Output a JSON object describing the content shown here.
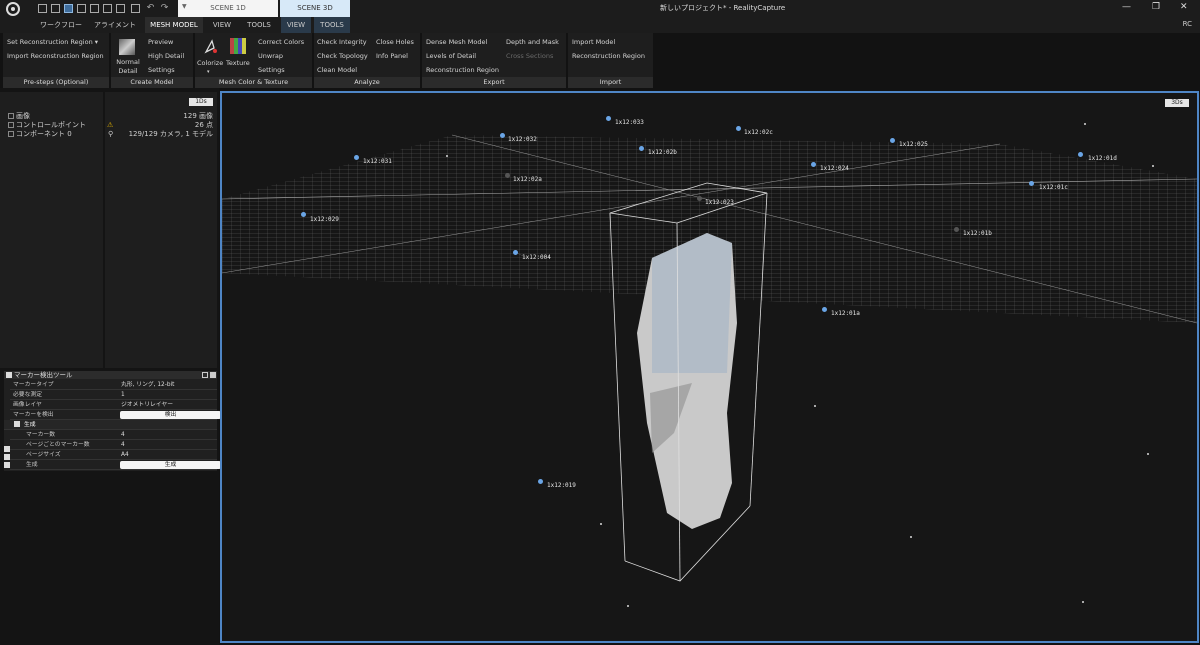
{
  "titlebar": {
    "scene_tabs": [
      "SCENE 1D",
      "SCENE 3D"
    ],
    "window_title": "新しいプロジェクト* - RealityCapture"
  },
  "menu": {
    "items": [
      "ワークフロー",
      "アライメント",
      "MESH MODEL",
      "VIEW",
      "TOOLS",
      "VIEW",
      "TOOLS"
    ],
    "right_label": "RC"
  },
  "ribbon": {
    "groups": [
      {
        "name": "Pre-steps (Optional)",
        "items": [
          "Set Reconstruction Region",
          "Import Reconstruction Region"
        ]
      },
      {
        "name": "Create Model",
        "big": "Normal Detail",
        "items": [
          "Preview",
          "High Detail",
          "Settings"
        ]
      },
      {
        "name": "Mesh Color & Texture",
        "big": [
          "Colorize",
          "Texture"
        ],
        "items": [
          "Correct Colors",
          "Unwrap",
          "Settings"
        ]
      },
      {
        "name": "Analyze",
        "items": [
          "Check Integrity",
          "Check Topology",
          "Clean Model",
          "Close Holes",
          "Info Panel"
        ]
      },
      {
        "name": "Export",
        "items": [
          "Dense Mesh Model",
          "Levels of Detail",
          "Reconstruction Region",
          "Depth and Mask",
          "Cross Sections"
        ]
      },
      {
        "name": "Import",
        "items": [
          "Import Model",
          "Reconstruction Region"
        ]
      }
    ]
  },
  "tree": {
    "items": [
      "画像",
      "コントロールポイント",
      "コンポーネント 0"
    ],
    "info": [
      "129 画像",
      "26 点",
      "129/129 カメラ, 1 モデル"
    ],
    "tag": "1Ds"
  },
  "marker_tool": {
    "title": "マーカー検出ツール",
    "rows": [
      {
        "k": "マーカータイプ",
        "v": "丸形, リング, 12-bit"
      },
      {
        "k": "必要な測定",
        "v": "1"
      },
      {
        "k": "画像レイヤ",
        "v": "ジオメトリレイヤー"
      },
      {
        "k": "マーカーを検出",
        "v": "検出"
      },
      {
        "k": "生成",
        "v": ""
      },
      {
        "k": "マーカー数",
        "v": "4"
      },
      {
        "k": "ページごとのマーカー数",
        "v": "4"
      },
      {
        "k": "ページサイズ",
        "v": "A4"
      },
      {
        "k": "生成",
        "v": "生成"
      }
    ]
  },
  "viewport": {
    "tag": "3Ds",
    "markers": [
      "1x12:033",
      "1x12:02c",
      "1x12:032",
      "1x12:02b",
      "1x12:025",
      "1x12:01d",
      "1x12:031",
      "1x12:024",
      "1x12:02a",
      "1x12:01c",
      "1x12:023",
      "1x12:029",
      "1x12:01b",
      "1x12:004",
      "1x12:01a",
      "1x12:019"
    ]
  },
  "colors": {
    "accent": "#4f86c6",
    "marker": "#6aa5e6",
    "grid": "#8a8a8a"
  }
}
